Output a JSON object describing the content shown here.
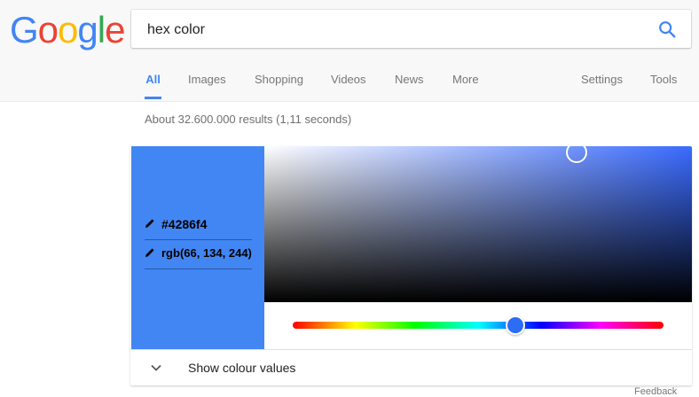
{
  "logo": {
    "letters": [
      "G",
      "o",
      "o",
      "g",
      "l",
      "e"
    ],
    "colors": [
      "#4285f4",
      "#ea4335",
      "#fbbc05",
      "#4285f4",
      "#34a853",
      "#ea4335"
    ]
  },
  "search": {
    "query": "hex color",
    "icon": "search-icon"
  },
  "tabs": {
    "all": "All",
    "images": "Images",
    "shopping": "Shopping",
    "videos": "Videos",
    "news": "News",
    "more": "More",
    "settings": "Settings",
    "tools": "Tools"
  },
  "stats": "About 32.600.000 results (1,11 seconds)",
  "color_picker": {
    "hex_value": "#4286f4",
    "rgb_value": "rgb(66, 134, 244)",
    "swatch_color": "#4286f4",
    "hue_color": "#2d6cf5",
    "pure_hue_color": "#3a6bff",
    "saturation": 0.73,
    "brightness": 0.96,
    "hue_fraction": 0.6
  },
  "footer": {
    "label": "Show colour values"
  },
  "feedback": "Feedback"
}
